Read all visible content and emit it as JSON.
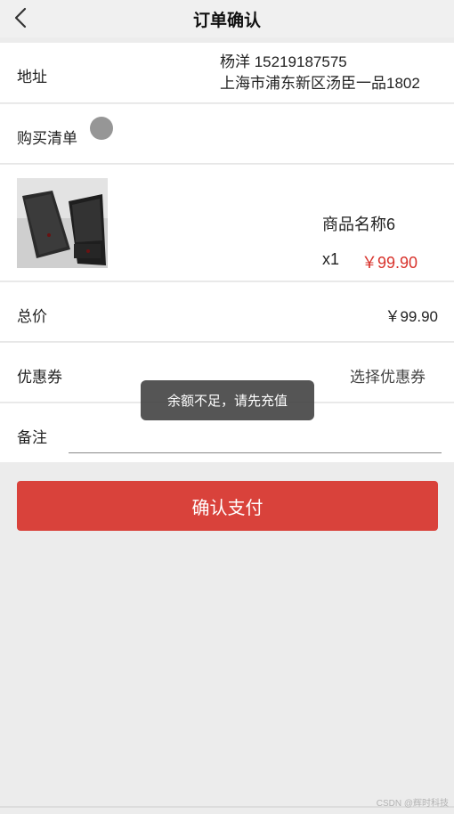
{
  "header": {
    "title": "订单确认"
  },
  "address": {
    "label": "地址",
    "name_phone": "杨洋 15219187575",
    "detail": "上海市浦东新区汤臣一品1802"
  },
  "cart": {
    "label": "购买清单"
  },
  "product": {
    "name": "商品名称6",
    "qty": "x1",
    "price": "￥99.90"
  },
  "total": {
    "label": "总价",
    "value": "￥99.90"
  },
  "coupon": {
    "label": "优惠券",
    "select": "选择优惠券"
  },
  "remark": {
    "label": "备注",
    "value": ""
  },
  "pay": {
    "label": "确认支付"
  },
  "toast": {
    "message": "余额不足，请先充值"
  },
  "watermark": {
    "text": "CSDN @辉时科技"
  },
  "colors": {
    "accent": "#d9423b",
    "price": "#d8322b"
  },
  "icons": {
    "back": "chevron-left-icon"
  }
}
